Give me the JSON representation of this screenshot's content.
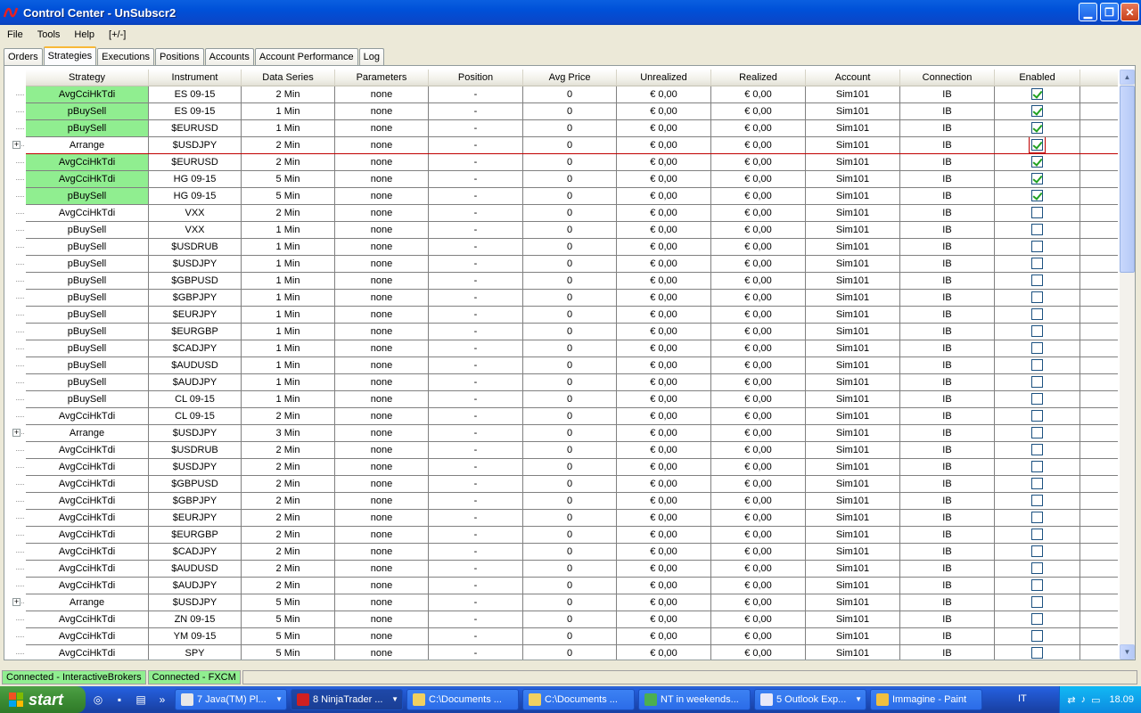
{
  "window": {
    "title": "Control Center - UnSubscr2"
  },
  "menu": [
    "File",
    "Tools",
    "Help",
    "[+/-]"
  ],
  "tabs": [
    "Orders",
    "Strategies",
    "Executions",
    "Positions",
    "Accounts",
    "Account Performance",
    "Log"
  ],
  "active_tab": "Strategies",
  "columns": [
    "Strategy",
    "Instrument",
    "Data Series",
    "Parameters",
    "Position",
    "Avg Price",
    "Unrealized",
    "Realized",
    "Account",
    "Connection",
    "Enabled"
  ],
  "rows": [
    {
      "strategy": "AvgCciHkTdi",
      "instrument": "ES 09-15",
      "series": "2 Min",
      "enabled": true,
      "green": true
    },
    {
      "strategy": "pBuySell",
      "instrument": "ES 09-15",
      "series": "1 Min",
      "enabled": true,
      "green": true
    },
    {
      "strategy": "pBuySell",
      "instrument": "$EURUSD",
      "series": "1 Min",
      "enabled": true,
      "green": true
    },
    {
      "strategy": "Arrange",
      "instrument": "$USDJPY",
      "series": "2 Min",
      "enabled": true,
      "green": false,
      "expander": true,
      "selected": true
    },
    {
      "strategy": "AvgCciHkTdi",
      "instrument": "$EURUSD",
      "series": "2 Min",
      "enabled": true,
      "green": true
    },
    {
      "strategy": "AvgCciHkTdi",
      "instrument": "HG 09-15",
      "series": "5 Min",
      "enabled": true,
      "green": true
    },
    {
      "strategy": "pBuySell",
      "instrument": "HG 09-15",
      "series": "5 Min",
      "enabled": true,
      "green": true
    },
    {
      "strategy": "AvgCciHkTdi",
      "instrument": "VXX",
      "series": "2 Min",
      "enabled": false
    },
    {
      "strategy": "pBuySell",
      "instrument": "VXX",
      "series": "1 Min",
      "enabled": false
    },
    {
      "strategy": "pBuySell",
      "instrument": "$USDRUB",
      "series": "1 Min",
      "enabled": false
    },
    {
      "strategy": "pBuySell",
      "instrument": "$USDJPY",
      "series": "1 Min",
      "enabled": false
    },
    {
      "strategy": "pBuySell",
      "instrument": "$GBPUSD",
      "series": "1 Min",
      "enabled": false
    },
    {
      "strategy": "pBuySell",
      "instrument": "$GBPJPY",
      "series": "1 Min",
      "enabled": false
    },
    {
      "strategy": "pBuySell",
      "instrument": "$EURJPY",
      "series": "1 Min",
      "enabled": false
    },
    {
      "strategy": "pBuySell",
      "instrument": "$EURGBP",
      "series": "1 Min",
      "enabled": false
    },
    {
      "strategy": "pBuySell",
      "instrument": "$CADJPY",
      "series": "1 Min",
      "enabled": false
    },
    {
      "strategy": "pBuySell",
      "instrument": "$AUDUSD",
      "series": "1 Min",
      "enabled": false
    },
    {
      "strategy": "pBuySell",
      "instrument": "$AUDJPY",
      "series": "1 Min",
      "enabled": false
    },
    {
      "strategy": "pBuySell",
      "instrument": "CL 09-15",
      "series": "1 Min",
      "enabled": false
    },
    {
      "strategy": "AvgCciHkTdi",
      "instrument": "CL 09-15",
      "series": "2 Min",
      "enabled": false
    },
    {
      "strategy": "Arrange",
      "instrument": "$USDJPY",
      "series": "3 Min",
      "enabled": false,
      "expander": true
    },
    {
      "strategy": "AvgCciHkTdi",
      "instrument": "$USDRUB",
      "series": "2 Min",
      "enabled": false
    },
    {
      "strategy": "AvgCciHkTdi",
      "instrument": "$USDJPY",
      "series": "2 Min",
      "enabled": false
    },
    {
      "strategy": "AvgCciHkTdi",
      "instrument": "$GBPUSD",
      "series": "2 Min",
      "enabled": false
    },
    {
      "strategy": "AvgCciHkTdi",
      "instrument": "$GBPJPY",
      "series": "2 Min",
      "enabled": false
    },
    {
      "strategy": "AvgCciHkTdi",
      "instrument": "$EURJPY",
      "series": "2 Min",
      "enabled": false
    },
    {
      "strategy": "AvgCciHkTdi",
      "instrument": "$EURGBP",
      "series": "2 Min",
      "enabled": false
    },
    {
      "strategy": "AvgCciHkTdi",
      "instrument": "$CADJPY",
      "series": "2 Min",
      "enabled": false
    },
    {
      "strategy": "AvgCciHkTdi",
      "instrument": "$AUDUSD",
      "series": "2 Min",
      "enabled": false
    },
    {
      "strategy": "AvgCciHkTdi",
      "instrument": "$AUDJPY",
      "series": "2 Min",
      "enabled": false
    },
    {
      "strategy": "Arrange",
      "instrument": "$USDJPY",
      "series": "5 Min",
      "enabled": false,
      "expander": true
    },
    {
      "strategy": "AvgCciHkTdi",
      "instrument": "ZN 09-15",
      "series": "5 Min",
      "enabled": false
    },
    {
      "strategy": "AvgCciHkTdi",
      "instrument": "YM 09-15",
      "series": "5 Min",
      "enabled": false
    },
    {
      "strategy": "AvgCciHkTdi",
      "instrument": "SPY",
      "series": "5 Min",
      "enabled": false
    }
  ],
  "defaults": {
    "parameters": "none",
    "position": "-",
    "avg_price": "0",
    "unrealized": "€ 0,00",
    "realized": "€ 0,00",
    "account": "Sim101",
    "connection": "IB"
  },
  "status": [
    "Connected - InteractiveBrokers",
    "Connected - FXCM"
  ],
  "taskbar": {
    "start": "start",
    "tasks": [
      {
        "label": "7 Java(TM) Pl...",
        "color": "#e8e8e8",
        "arrow": true
      },
      {
        "label": "8 NinjaTrader ...",
        "color": "#d02020",
        "arrow": true,
        "active": true
      },
      {
        "label": "C:\\Documents ...",
        "color": "#f0d060"
      },
      {
        "label": "C:\\Documents ...",
        "color": "#f0d060"
      },
      {
        "label": "NT in weekends...",
        "color": "#4caf50"
      },
      {
        "label": "5 Outlook Exp...",
        "color": "#e8e8f8",
        "arrow": true
      },
      {
        "label": "Immagine - Paint",
        "color": "#f0c040"
      }
    ],
    "language": "IT",
    "clock": "18.09"
  },
  "colors": {
    "green_cell": "#90ee90",
    "title_blue": "#0050d8"
  }
}
